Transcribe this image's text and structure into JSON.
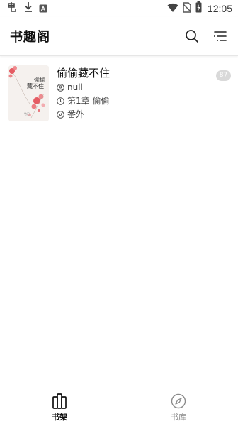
{
  "status_bar": {
    "time": "12:05",
    "battery_level": "charging"
  },
  "app_bar": {
    "title": "书趣阁"
  },
  "books": [
    {
      "title": "偷偷藏不住",
      "author": "null",
      "latest_chapter": "第1章 偷偷",
      "source": "番外",
      "unread_count": "87",
      "cover_title": "偷偷藏不住",
      "cover_subtitle": "竹已"
    }
  ],
  "bottom_nav": {
    "items": [
      {
        "label": "书架",
        "icon": "bookshelf-icon",
        "active": true
      },
      {
        "label": "书库",
        "icon": "compass-icon",
        "active": false
      }
    ]
  },
  "colors": {
    "active": "#111111",
    "inactive": "#8a8a8a",
    "badge": "#d9d9d9",
    "cover_accent": "#d9363e"
  }
}
